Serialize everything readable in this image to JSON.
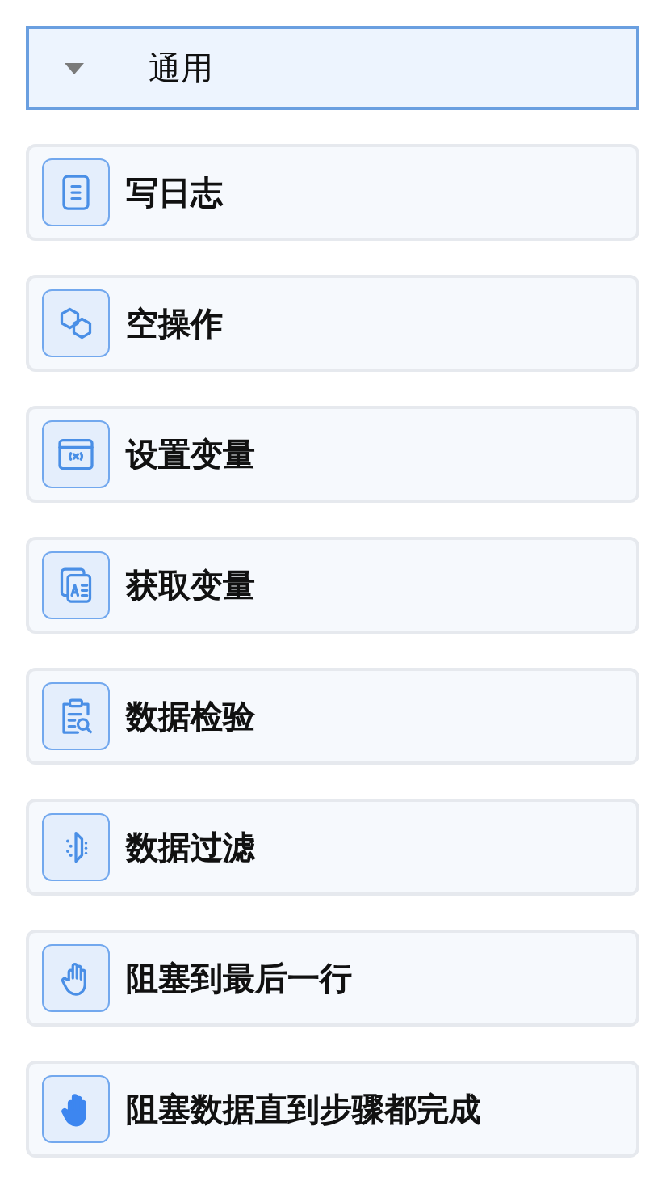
{
  "group": {
    "title": "通用",
    "expanded": true
  },
  "items": [
    {
      "label": "写日志"
    },
    {
      "label": "空操作"
    },
    {
      "label": "设置变量"
    },
    {
      "label": "获取变量"
    },
    {
      "label": "数据检验"
    },
    {
      "label": "数据过滤"
    },
    {
      "label": "阻塞到最后一行"
    },
    {
      "label": "阻塞数据直到步骤都完成"
    }
  ]
}
